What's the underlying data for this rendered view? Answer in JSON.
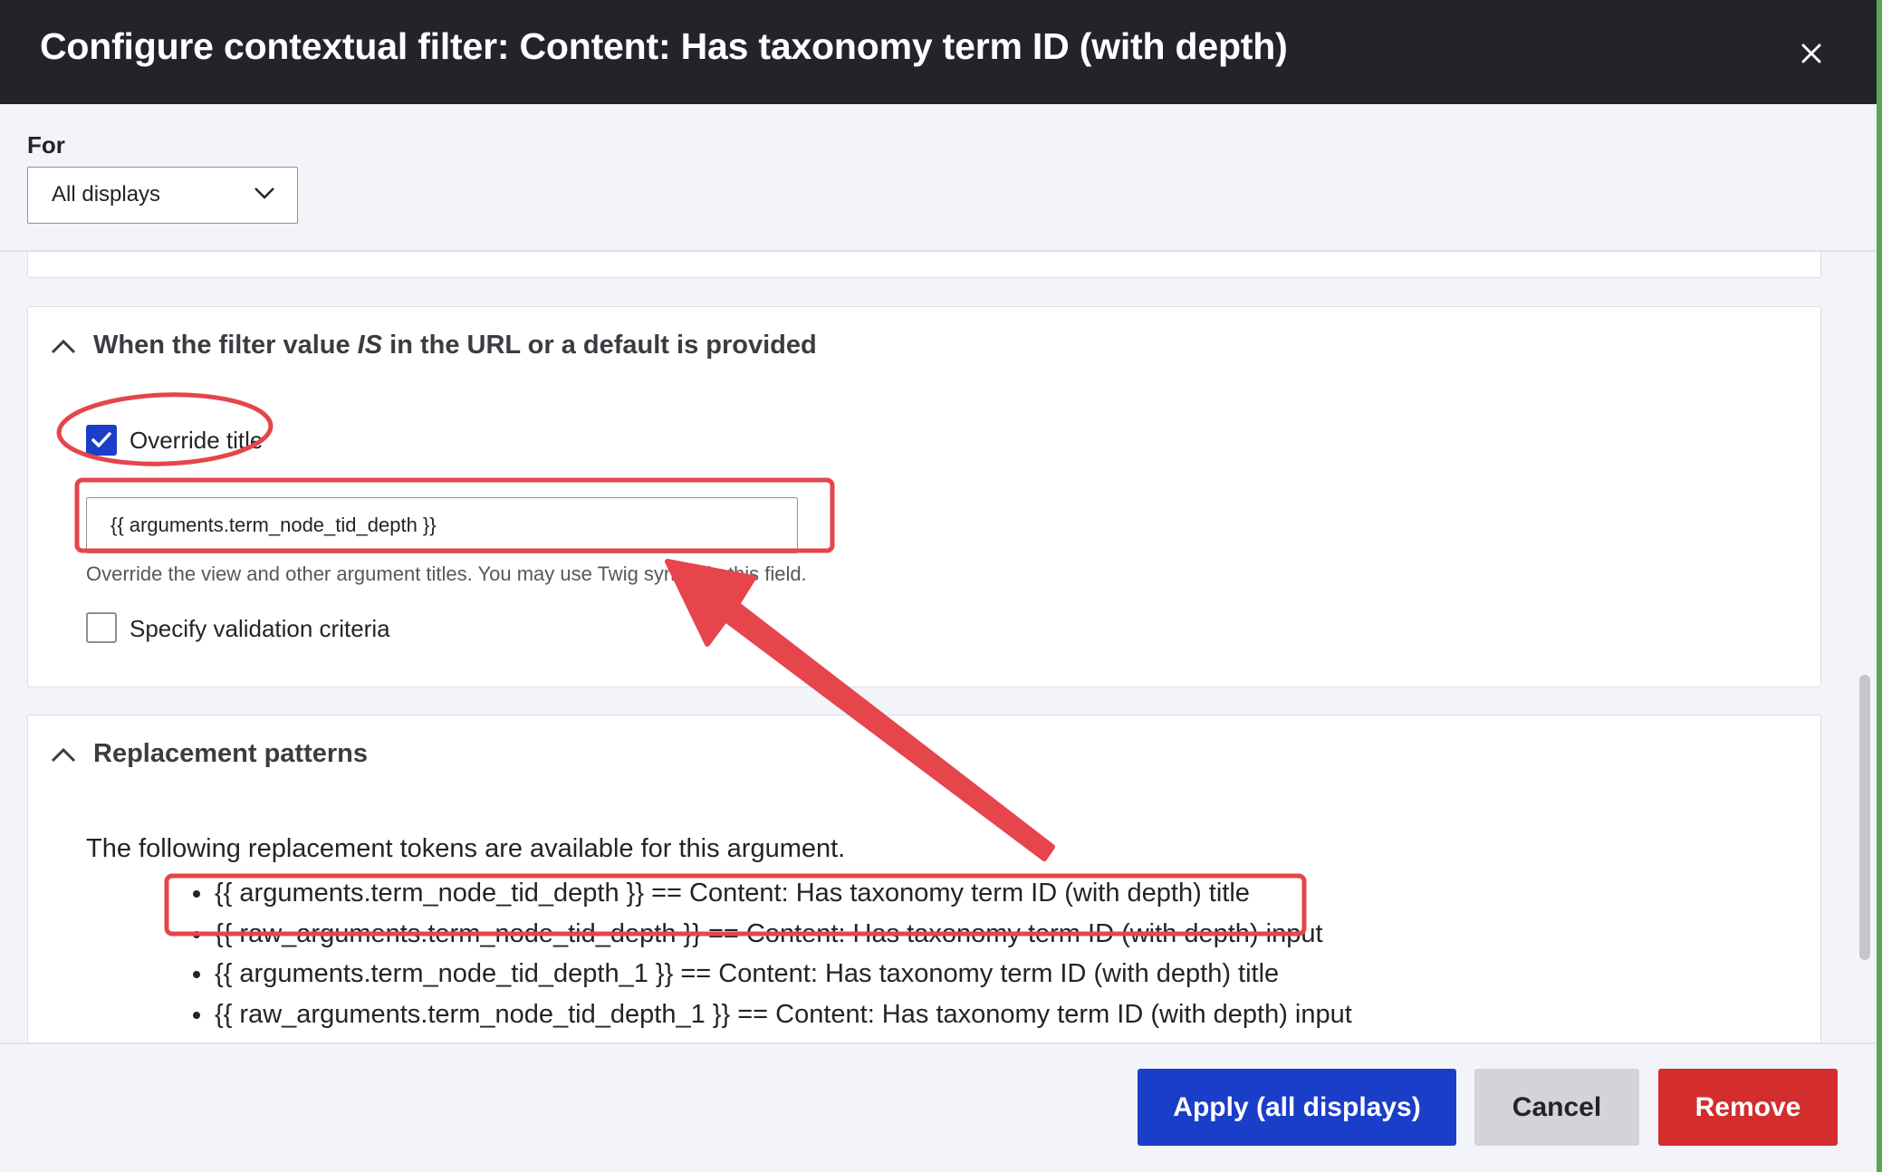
{
  "dialog": {
    "title": "Configure contextual filter: Content: Has taxonomy term ID (with depth)",
    "close_label": "×"
  },
  "for_section": {
    "label": "For",
    "select_value": "All displays"
  },
  "when_section": {
    "heading_prefix": "When the filter value ",
    "heading_em": "IS",
    "heading_suffix": " in the URL or a default is provided",
    "override_title": {
      "label": "Override title",
      "checked": true,
      "input_value": "{{ arguments.term_node_tid_depth }}",
      "help": "Override the view and other argument titles. You may use Twig syntax in this field."
    },
    "validation": {
      "label": "Specify validation criteria",
      "checked": false
    }
  },
  "replacement_section": {
    "heading": "Replacement patterns",
    "intro": "The following replacement tokens are available for this argument.",
    "tokens": [
      "{{ arguments.term_node_tid_depth }} == Content: Has taxonomy term ID (with depth) title",
      "{{ raw_arguments.term_node_tid_depth }} == Content: Has taxonomy term ID (with depth) input",
      "{{ arguments.term_node_tid_depth_1 }} == Content: Has taxonomy term ID (with depth) title",
      "{{ raw_arguments.term_node_tid_depth_1 }} == Content: Has taxonomy term ID (with depth) input"
    ]
  },
  "footer": {
    "apply_label": "Apply (all displays)",
    "cancel_label": "Cancel",
    "remove_label": "Remove"
  },
  "colors": {
    "titlebar": "#232429",
    "primary": "#1b3ec9",
    "danger": "#d32d2d",
    "annotation": "#e5454b"
  }
}
